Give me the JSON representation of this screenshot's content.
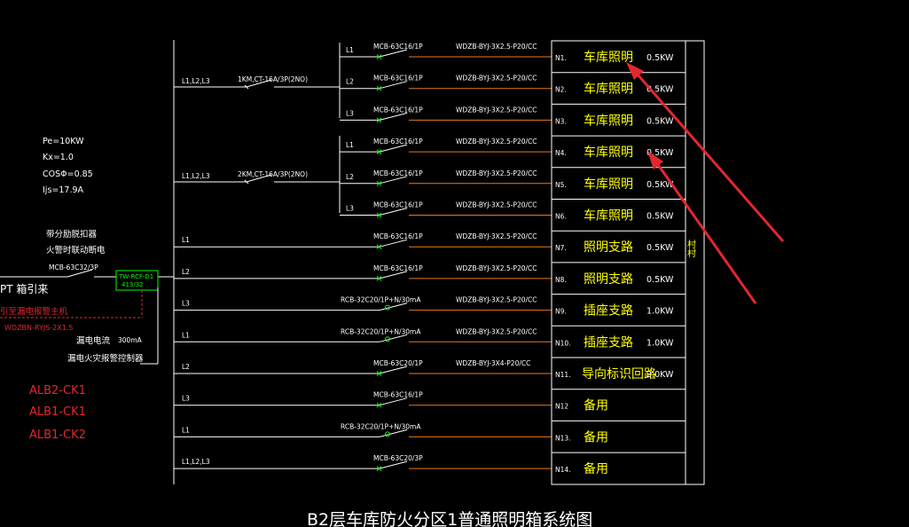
{
  "title": "B2层车库防火分区1普通照明箱系统图",
  "params": [
    "Pe=10KW",
    "Kx=1.0",
    "COSΦ=0.85",
    "Ijs=17.9A"
  ],
  "incoming": {
    "fire_note_1": "带分励脱扣器",
    "fire_note_2": "火警时联动断电",
    "main_breaker": "MCB-63C32/3P",
    "device_box_1": "TW-RCF-D1",
    "device_box_2": "413/32",
    "source_label": "PT 箱引来",
    "leak_note": "引至漏电报警主机",
    "cable": "WDZBN-RYJS-2X1.5",
    "leak_current_label": "漏电电流",
    "leak_current_value": "300mA",
    "leak_device": "漏电火灾报警控制器"
  },
  "red_labels": [
    "ALB2-CK1",
    "ALB1-CK1",
    "ALB1-CK2"
  ],
  "contactors": [
    {
      "phases": "L1,L2,L3",
      "label": "1KM,CT-16A/3P(2NO)"
    },
    {
      "phases": "L1,L2,L3",
      "label": "2KM,CT-16A/3P(2NO)"
    }
  ],
  "circuits": [
    {
      "phase": "L1",
      "breaker": "MCB-63C16/1P",
      "cable": "WDZB-BYJ-3X2.5-P20/CC",
      "no": "N1.",
      "name": "车库照明",
      "power": "0.5KW",
      "type": "mcb"
    },
    {
      "phase": "L2",
      "breaker": "MCB-63C16/1P",
      "cable": "WDZB-BYJ-3X2.5-P20/CC",
      "no": "N2.",
      "name": "车库照明",
      "power": "0.5KW",
      "type": "mcb"
    },
    {
      "phase": "L3",
      "breaker": "MCB-63C16/1P",
      "cable": "WDZB-BYJ-3X2.5-P20/CC",
      "no": "N3.",
      "name": "车库照明",
      "power": "0.5KW",
      "type": "mcb"
    },
    {
      "phase": "L1",
      "breaker": "MCB-63C16/1P",
      "cable": "WDZB-BYJ-3X2.5-P20/CC",
      "no": "N4.",
      "name": "车库照明",
      "power": "0.5KW",
      "type": "mcb"
    },
    {
      "phase": "L2",
      "breaker": "MCB-63C16/1P",
      "cable": "WDZB-BYJ-3X2.5-P20/CC",
      "no": "N5.",
      "name": "车库照明",
      "power": "0.5KW",
      "type": "mcb"
    },
    {
      "phase": "L3",
      "breaker": "MCB-63C16/1P",
      "cable": "WDZB-BYJ-3X2.5-P20/CC",
      "no": "N6.",
      "name": "车库照明",
      "power": "0.5KW",
      "type": "mcb"
    },
    {
      "phase": "L1",
      "breaker": "MCB-63C16/1P",
      "cable": "WDZB-BYJ-3X2.5-P20/CC",
      "no": "N7.",
      "name": "照明支路",
      "power": "0.5KW",
      "type": "mcb"
    },
    {
      "phase": "L2",
      "breaker": "MCB-63C16/1P",
      "cable": "WDZB-BYJ-3X2.5-P20/CC",
      "no": "N8.",
      "name": "照明支路",
      "power": "0.5KW",
      "type": "mcb"
    },
    {
      "phase": "L3",
      "breaker": "RCB-32C20/1P+N/30mA",
      "cable": "WDZB-BYJ-3X2.5-P20/CC",
      "no": "N9.",
      "name": "插座支路",
      "power": "1.0KW",
      "type": "rcb"
    },
    {
      "phase": "L1",
      "breaker": "RCB-32C20/1P+N/30mA",
      "cable": "WDZB-BYJ-3X2.5-P20/CC",
      "no": "N10.",
      "name": "插座支路",
      "power": "1.0KW",
      "type": "rcb"
    },
    {
      "phase": "L2",
      "breaker": "MCB-63C20/1P",
      "cable": "WDZB-BYJ-3X4-P20/CC",
      "no": "N11.",
      "name": "导向标识回路",
      "power": "2.0KW",
      "type": "mcb"
    },
    {
      "phase": "L3",
      "breaker": "MCB-63C16/1P",
      "cable": "",
      "no": "N12",
      "name": "备用",
      "power": "",
      "type": "mcb"
    },
    {
      "phase": "L1",
      "breaker": "RCB-32C20/1P+N/30mA",
      "cable": "",
      "no": "N13.",
      "name": "备用",
      "power": "",
      "type": "rcb"
    },
    {
      "phase": "L1,L2,L3",
      "breaker": "MCB-63C20/3P",
      "cable": "",
      "no": "N14.",
      "name": "备用",
      "power": "",
      "type": "mcb"
    }
  ],
  "side_label": "村村",
  "colors": {
    "background": "#000000",
    "line": "#ffffff",
    "feeder": "#e67a1e",
    "name_text": "#ffff00",
    "device_box": "#00ff00",
    "annotation": "#e0282e"
  }
}
